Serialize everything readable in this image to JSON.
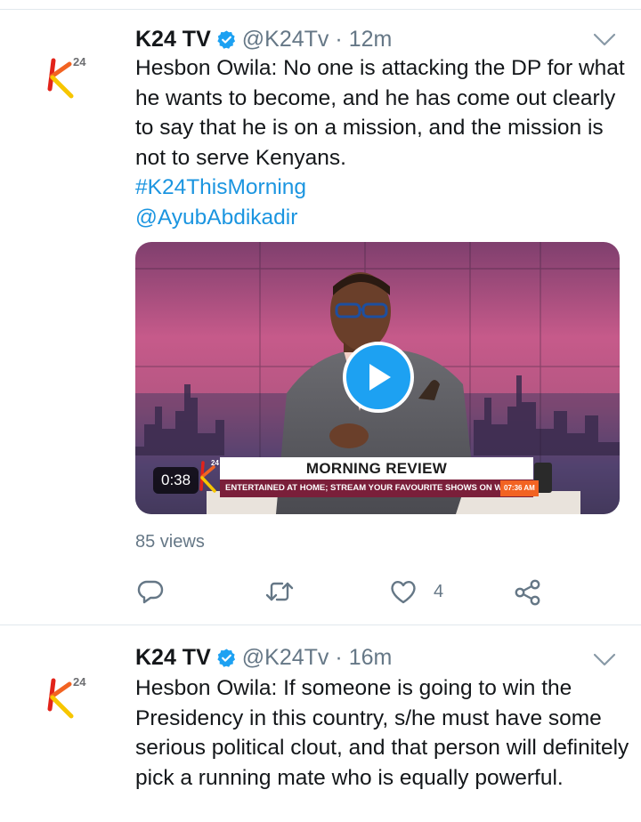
{
  "tweets": [
    {
      "display_name": "K24 TV",
      "handle": "@K24Tv",
      "separator": "·",
      "time": "12m",
      "text": "Hesbon Owila: No one is attacking the DP for what he wants to become, and he has come out clearly to say that he is on a mission, and the mission is not to serve Kenyans.",
      "hashtag": "#K24ThisMorning",
      "mention": "@AyubAbdikadir",
      "media": {
        "duration": "0:38",
        "banner_title": "MORNING REVIEW",
        "banner_ticker": "ENTERTAINED AT HOME; STREAM YOUR FAVOURITE SHOWS ON WWW.K",
        "banner_clock": "07:36 AM"
      },
      "views": "85 views",
      "like_count": "4"
    },
    {
      "display_name": "K24 TV",
      "handle": "@K24Tv",
      "separator": "·",
      "time": "16m",
      "text": "Hesbon Owila: If someone is going to win the Presidency in this country, s/he must have some serious political clout, and that person will definitely pick a running mate who is equally powerful."
    }
  ],
  "colors": {
    "link": "#1b95e0",
    "verified": "#1da1f2",
    "secondary_text": "#657786",
    "brand_orange": "#f26322",
    "brand_yellow": "#f7c600",
    "brand_red": "#e2231a"
  },
  "icons": {
    "verified": "verified-badge-icon",
    "caret": "chevron-down-icon",
    "reply": "reply-icon",
    "retweet": "retweet-icon",
    "like": "heart-icon",
    "share": "share-icon",
    "play": "play-icon"
  }
}
